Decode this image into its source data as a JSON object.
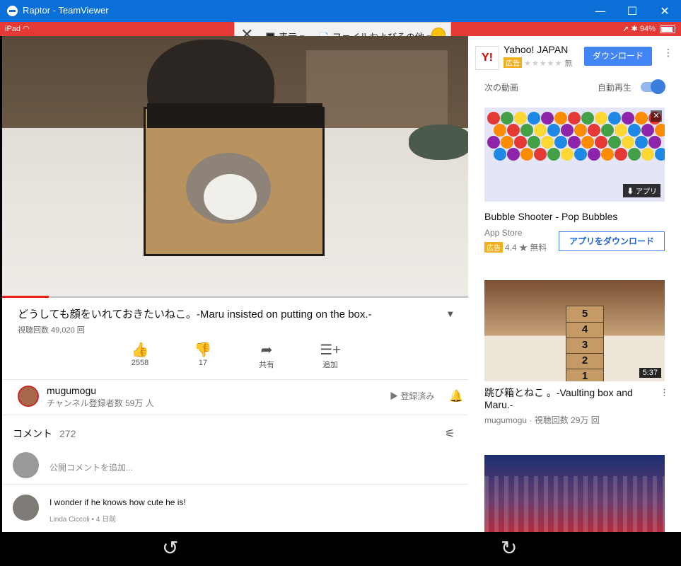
{
  "window": {
    "title": "Raptor - TeamViewer",
    "minimize": "—",
    "maximize": "☐",
    "close": "✕"
  },
  "status": {
    "device": "iPad",
    "battery": "94%",
    "wifi": "wifi-icon",
    "indicators": "➚ ✱"
  },
  "teamviewer": {
    "close": "✕",
    "view_label": "表示 ▾",
    "files_label": "ファイルおよびその他 ▾",
    "mini": "▦ ⤢ ︿"
  },
  "video": {
    "title": "どうしても顔をいれておきたいねこ。-Maru insisted on putting on the box.-",
    "views": "視聴回数 49,020 回",
    "progress": 0.1
  },
  "actions": [
    {
      "icon": "👍",
      "label": "2558"
    },
    {
      "icon": "👎",
      "label": "17"
    },
    {
      "icon": "➦",
      "label": "共有"
    },
    {
      "icon": "☰+",
      "label": "追加"
    }
  ],
  "channel": {
    "name": "mugumogu",
    "subs": "チャンネル登録者数 59万 人",
    "subscribed": "登録済み"
  },
  "comments": {
    "heading": "コメント",
    "count": "272",
    "add_placeholder": "公開コメントを追加...",
    "items": [
      {
        "text": "I wonder if he knows how cute he is!",
        "author": "Linda Ciccoli",
        "time": "4 日前"
      }
    ]
  },
  "ad": {
    "logo": "Y!",
    "name": "Yahoo! JAPAN",
    "badge": "広告",
    "stars": "★★★★★",
    "free": "無",
    "button": "ダウンロード"
  },
  "upnext": {
    "label": "次の動画",
    "autoplay_label": "自動再生",
    "autoplay_on": true
  },
  "suggestions": [
    {
      "title": "Bubble Shooter - Pop Bubbles",
      "store": "App Store",
      "badge": "広告",
      "rating": "4.4 ★ 無料",
      "button": "アプリをダウンロード",
      "thumb_badge": "⬇ アプリ"
    },
    {
      "title": "跳び箱とねこ 。-Vaulting box and Maru.-",
      "meta": "mugumogu · 視聴回数 29万 回",
      "duration": "5:37",
      "box_numbers": [
        "5",
        "4",
        "3",
        "2",
        "1"
      ]
    },
    {
      "title": ""
    }
  ],
  "navigation": {
    "back": "↺",
    "forward": "↻"
  },
  "colors": {
    "titlebar": "#0a6fd6",
    "statusbar": "#e53935",
    "accent": "#4285f4",
    "progress": "#e62117"
  }
}
